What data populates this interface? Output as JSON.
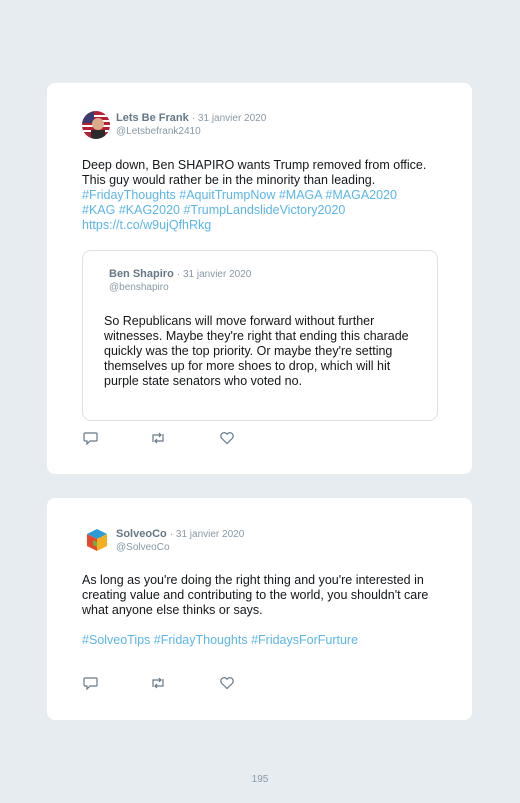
{
  "tweets": [
    {
      "author": "Lets Be Frank",
      "date": "· 31 janvier 2020",
      "handle": "@Letsbefrank2410",
      "avatar_icon": "flag-portrait-avatar",
      "text_plain": "Deep down, Ben SHAPIRO wants Trump removed from office. This guy would rather be in the minority than leading.",
      "hashtags_line1": "#FridayThoughts #AquitTrumpNow #MAGA #MAGA2020",
      "hashtags_line2": "#KAG #KAG2020 #TrumpLandslideVictory2020",
      "url": "https://t.co/w9ujQfhRkg",
      "quoted": {
        "author": "Ben Shapiro",
        "date": "· 31 janvier 2020",
        "handle": "@benshapiro",
        "text": "So Republicans will move forward without further witnesses. Maybe they're right that ending this charade quickly was the top priority. Or maybe they're setting themselves up for more shoes to drop, which will hit purple state senators who voted no."
      },
      "actions": [
        "reply-icon",
        "retweet-icon",
        "like-icon"
      ]
    },
    {
      "author": "SolveoCo",
      "date": "· 31 janvier 2020",
      "handle": "@SolveoCo",
      "avatar_icon": "solveo-cube-logo",
      "text_plain": "As long as you're doing the right thing and you're interested in creating value and contributing to the world, you shouldn't care what anyone else thinks or says.",
      "hashtags": "#SolveoTips #FridayThoughts #FridaysForFurture",
      "actions": [
        "reply-icon",
        "retweet-icon",
        "like-icon"
      ]
    }
  ],
  "page_number": "195",
  "colors": {
    "link": "#5bb6e8",
    "background": "#e6ecf0",
    "card": "#ffffff"
  }
}
